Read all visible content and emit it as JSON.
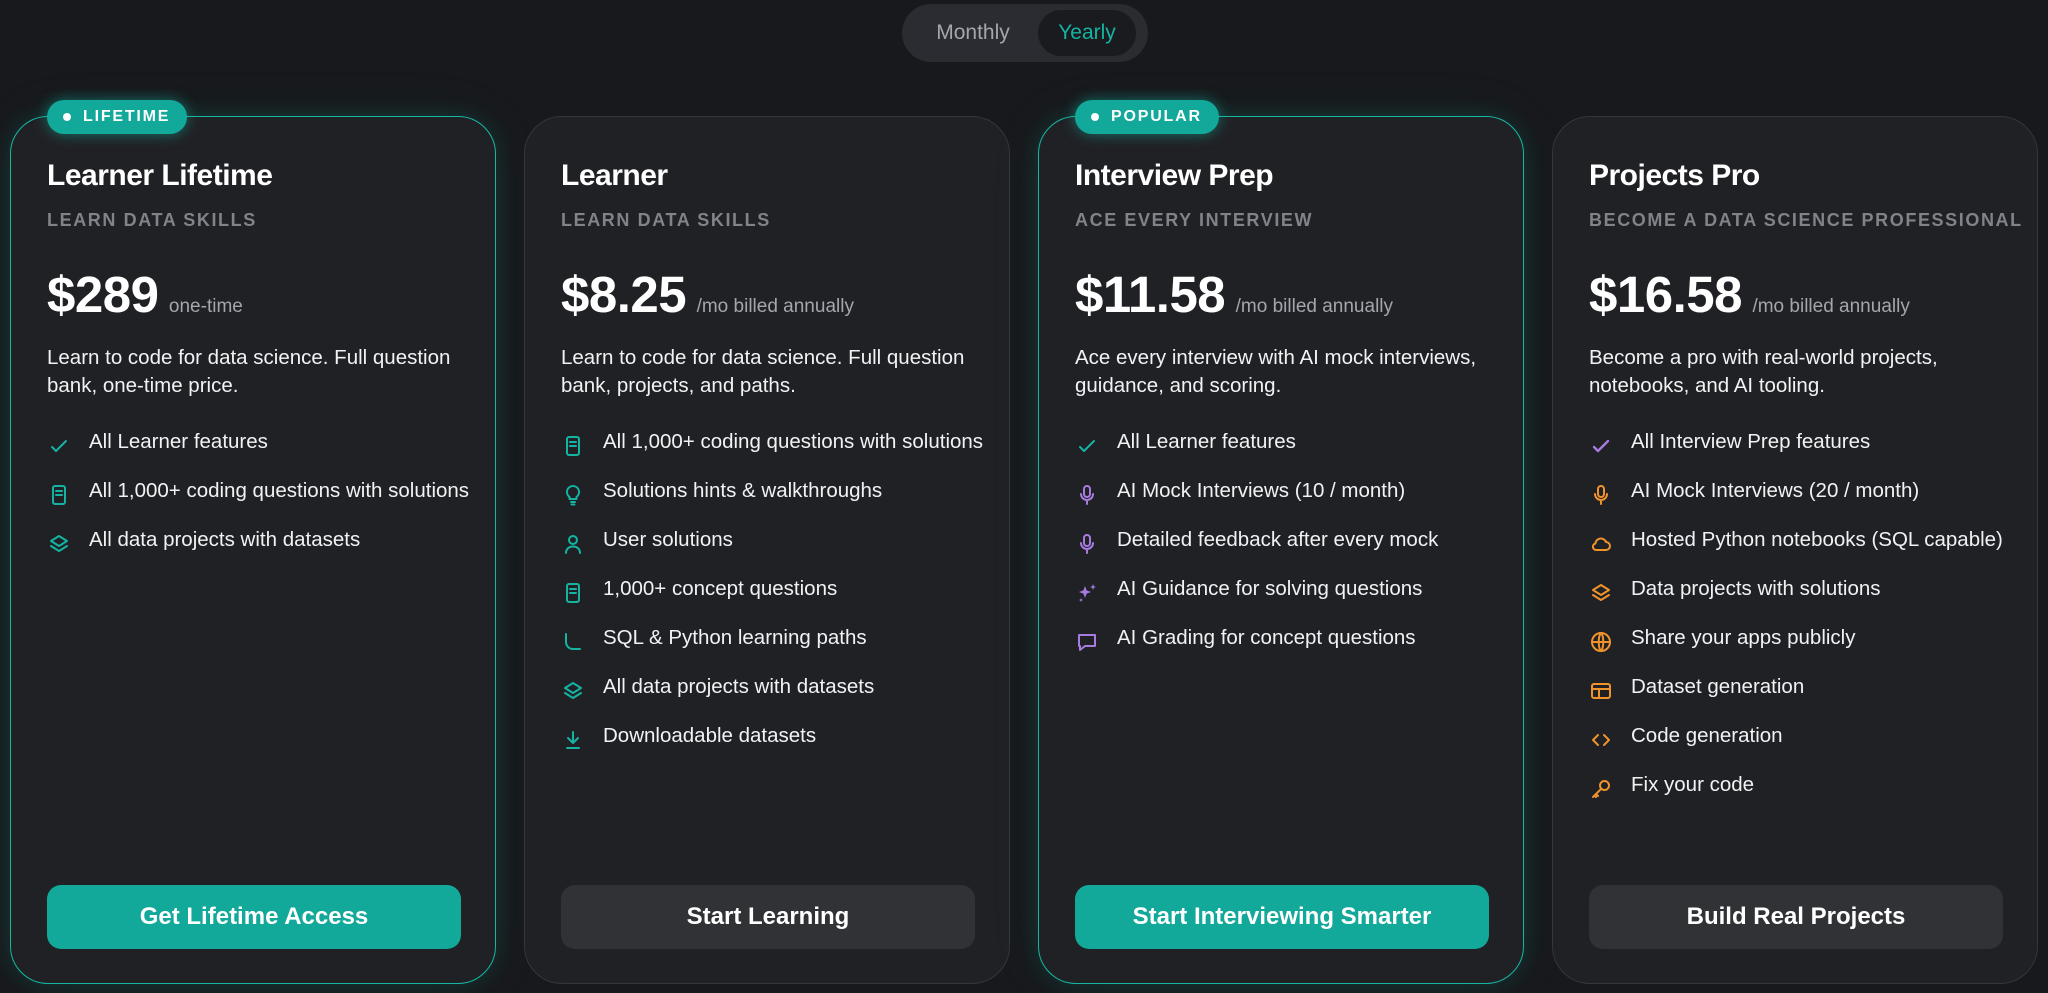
{
  "billing_toggle": {
    "monthly_label": "Monthly",
    "yearly_label": "Yearly",
    "selected": "Yearly"
  },
  "colors": {
    "teal_accent": "#12a89a",
    "purple_accent": "#a77be0",
    "orange_accent": "#f0932b",
    "background": "#18191c",
    "card": "#202125"
  },
  "plans": [
    {
      "badge": "LIFETIME",
      "title": "Learner Lifetime",
      "subtitle": "LEARN DATA SKILLS",
      "price": "$289",
      "price_note": "one-time",
      "description": "Learn to code for data science. Full question bank, one-time price.",
      "features": [
        {
          "icon": "check-icon",
          "text": "All Learner features"
        },
        {
          "icon": "document-icon",
          "text": "All 1,000+ coding questions with solutions"
        },
        {
          "icon": "layers-icon",
          "text": "All data projects with datasets"
        }
      ],
      "cta": "Get Lifetime Access"
    },
    {
      "badge": "",
      "title": "Learner",
      "subtitle": "LEARN DATA SKILLS",
      "price": "$8.25",
      "price_note": "/mo billed annually",
      "description": "Learn to code for data science. Full question bank, projects, and paths.",
      "features": [
        {
          "icon": "document-icon",
          "text": "All 1,000+ coding questions with solutions"
        },
        {
          "icon": "lightbulb-icon",
          "text": "Solutions hints & walkthroughs"
        },
        {
          "icon": "user-icon",
          "text": "User solutions"
        },
        {
          "icon": "document-icon",
          "text": "1,000+ concept questions"
        },
        {
          "icon": "path-icon",
          "text": "SQL & Python learning paths"
        },
        {
          "icon": "layers-icon",
          "text": "All data projects with datasets"
        },
        {
          "icon": "download-icon",
          "text": "Downloadable datasets"
        }
      ],
      "cta": "Start Learning"
    },
    {
      "badge": "POPULAR",
      "title": "Interview Prep",
      "subtitle": "ACE EVERY INTERVIEW",
      "price": "$11.58",
      "price_note": "/mo billed annually",
      "description": "Ace every interview with AI mock interviews, guidance, and scoring.",
      "features": [
        {
          "icon": "check-icon",
          "text": "All Learner features"
        },
        {
          "icon": "microphone-icon",
          "text": "AI Mock Interviews (10 / month)"
        },
        {
          "icon": "microphone-icon",
          "text": "Detailed feedback after every mock"
        },
        {
          "icon": "sparkle-icon",
          "text": "AI Guidance for solving questions"
        },
        {
          "icon": "chat-icon",
          "text": "AI Grading for concept questions"
        }
      ],
      "cta": "Start Interviewing Smarter"
    },
    {
      "badge": "",
      "title": "Projects Pro",
      "subtitle": "BECOME A DATA SCIENCE PROFESSIONAL",
      "price": "$16.58",
      "price_note": "/mo billed annually",
      "description": "Become a pro with real-world projects, notebooks, and AI tooling.",
      "features": [
        {
          "icon": "check-icon",
          "text": "All Interview Prep features"
        },
        {
          "icon": "microphone-icon",
          "text": "AI Mock Interviews (20 / month)"
        },
        {
          "icon": "cloud-icon",
          "text": "Hosted Python notebooks (SQL capable)"
        },
        {
          "icon": "layers-icon",
          "text": "Data projects with solutions"
        },
        {
          "icon": "globe-icon",
          "text": "Share your apps publicly"
        },
        {
          "icon": "table-icon",
          "text": "Dataset generation"
        },
        {
          "icon": "code-icon",
          "text": "Code generation"
        },
        {
          "icon": "key-icon",
          "text": "Fix your code"
        }
      ],
      "cta": "Build Real Projects"
    }
  ]
}
